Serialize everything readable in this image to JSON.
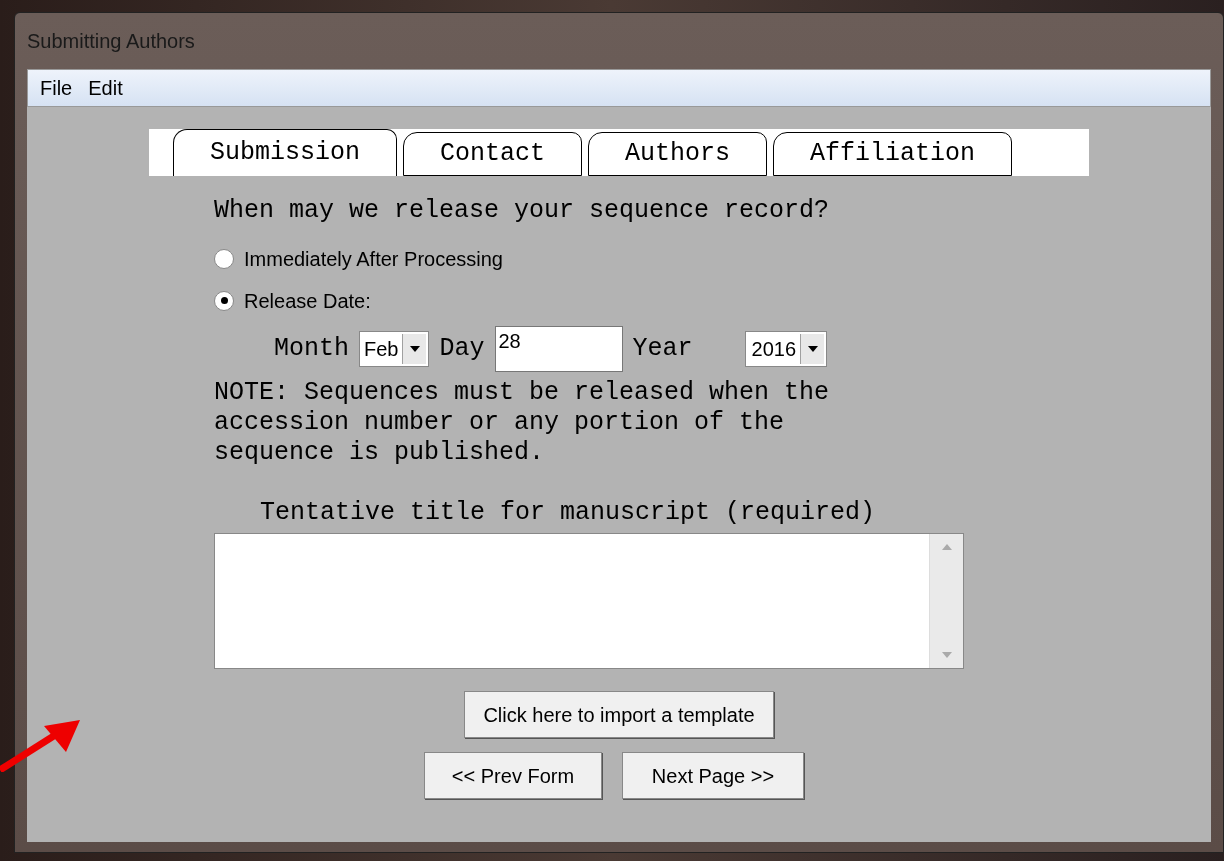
{
  "window": {
    "title": "Submitting Authors"
  },
  "menu": [
    "File",
    "Edit"
  ],
  "tabs": [
    {
      "label": "Submission",
      "selected": true
    },
    {
      "label": "Contact",
      "selected": false
    },
    {
      "label": "Authors",
      "selected": false
    },
    {
      "label": "Affiliation",
      "selected": false
    }
  ],
  "question": "When may we release your sequence record?",
  "release_options": [
    {
      "label": "Immediately After Processing",
      "selected": false
    },
    {
      "label": "Release Date:",
      "selected": true
    }
  ],
  "date": {
    "month_label": "Month",
    "month": "Feb",
    "day_label": "Day",
    "day": "28",
    "year_label": "Year",
    "year": "2016"
  },
  "note": "NOTE: Sequences must be released when the accession number or any portion of the sequence is published.",
  "title_field": {
    "label": "Tentative title for manuscript (required)"
  },
  "buttons": {
    "import": "Click here to import a template",
    "prev": "<< Prev Form",
    "next": "Next Page >>"
  }
}
